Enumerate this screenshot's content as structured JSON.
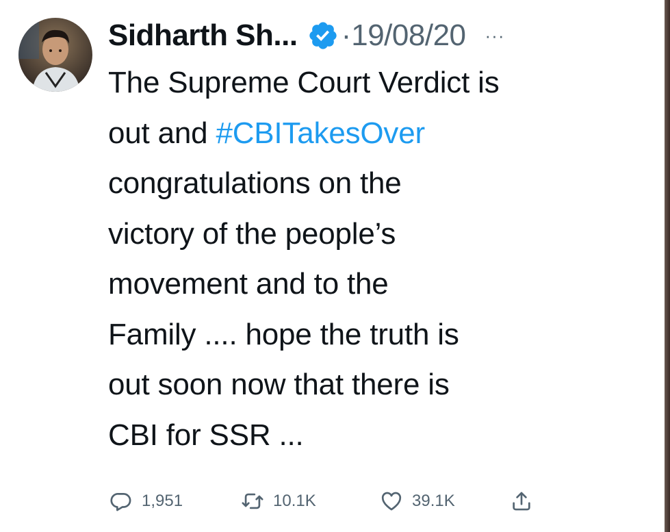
{
  "tweet": {
    "author_name": "Sidharth Sh...",
    "separator": "·",
    "date": "19/08/20",
    "more": "···",
    "text_before": "The Supreme Court Verdict is\nout and ",
    "hashtag": "#CBITakesOver",
    "text_after": "\ncongratulations on the\nvictory of the people’s\nmovement and to the\nFamily .... hope the truth is\nout soon now that there is\nCBI for SSR ..."
  },
  "actions": {
    "replies": "1,951",
    "retweets": "10.1K",
    "likes": "39.1K"
  },
  "colors": {
    "text": "#0f1419",
    "secondary": "#536471",
    "link": "#1d9bf0",
    "verified": "#1d9bf0"
  },
  "icons": [
    "verified-badge-icon",
    "reply-icon",
    "retweet-icon",
    "like-icon",
    "share-icon"
  ]
}
